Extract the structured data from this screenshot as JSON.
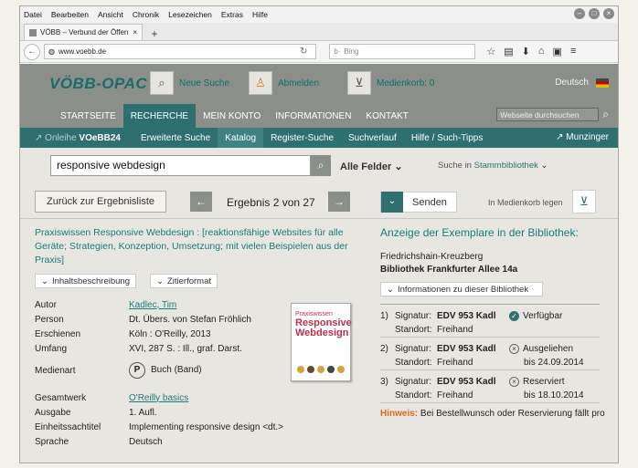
{
  "browser": {
    "menu": [
      "Datei",
      "Bearbeiten",
      "Ansicht",
      "Chronik",
      "Lesezeichen",
      "Extras",
      "Hilfe"
    ],
    "tab_title": "VÖBB – Verbund der Öffent…",
    "url": "www.voebb.de",
    "search_placeholder": "Bing"
  },
  "header": {
    "logo": "VÖBB-OPAC",
    "new_search": "Neue Suche",
    "logout": "Abmelden",
    "cart": "Medienkorb: 0",
    "language": "Deutsch"
  },
  "mainnav": {
    "items": [
      "STARTSEITE",
      "RECHERCHE",
      "MEIN KONTO",
      "INFORMATIONEN",
      "KONTAKT"
    ],
    "site_search_placeholder": "Webseite durchsuchen"
  },
  "subnav": {
    "online_prefix": "Onleihe",
    "online_name": "VOeBB24",
    "items": [
      "Erweiterte Suche",
      "Katalog",
      "Register-Suche",
      "Suchverlauf",
      "Hilfe / Such-Tipps"
    ],
    "user": "Munzinger"
  },
  "search": {
    "query": "responsive webdesign",
    "fields": "Alle Felder",
    "search_in_prefix": "Suche in",
    "search_in_value": "Stammbibliothek"
  },
  "actions": {
    "back": "Zurück zur Ergebnisliste",
    "result": "Ergebnis 2 von 27",
    "send": "Senden",
    "add_to_cart": "In Medienkorb legen"
  },
  "record": {
    "title": "Praxiswissen Responsive Webdesign : [reaktionsfähige Websites für alle Geräte; Strategien, Konzeption, Umsetzung; mit vielen Beispielen aus der Praxis]",
    "description_btn": "Inhaltsbeschreibung",
    "cite_btn": "Zitierformat",
    "cover_line1": "Praxiswissen",
    "cover_line2": "Responsive",
    "cover_line3": "Webdesign",
    "fields": [
      {
        "k": "Autor",
        "v": "Kadlec, Tim",
        "link": true
      },
      {
        "k": "Person",
        "v": "Dt. Übers. von Stefan Fröhlich",
        "link": false
      },
      {
        "k": "Erschienen",
        "v": "Köln : O'Reilly, 2013",
        "link": false
      },
      {
        "k": "Umfang",
        "v": "XVI, 287 S. : Ill., graf. Darst.",
        "link": false
      }
    ],
    "media_label": "Medienart",
    "media_value": "Buch (Band)",
    "fields2": [
      {
        "k": "Gesamtwerk",
        "v": "O'Reilly basics",
        "link": true
      },
      {
        "k": "Ausgabe",
        "v": "1. Aufl.",
        "link": false
      },
      {
        "k": "Einheitssachtitel",
        "v": "Implementing responsive design <dt.>",
        "link": false
      },
      {
        "k": "Sprache",
        "v": "Deutsch",
        "link": false
      }
    ]
  },
  "holdings": {
    "heading": "Anzeige der Exemplare in der Bibliothek:",
    "district": "Friedrichshain-Kreuzberg",
    "branch": "Bibliothek Frankfurter Allee 14a",
    "info_btn": "Informationen zu dieser Bibliothek",
    "sig_label": "Signatur:",
    "loc_label": "Standort:",
    "copies": [
      {
        "n": "1)",
        "sig": "EDV 953 Kadl",
        "loc": "Freihand",
        "status": "Verfügbar",
        "status2": "",
        "available": true
      },
      {
        "n": "2)",
        "sig": "EDV 953 Kadl",
        "loc": "Freihand",
        "status": "Ausgeliehen",
        "status2": "bis 24.09.2014",
        "available": false
      },
      {
        "n": "3)",
        "sig": "EDV 953 Kadl",
        "loc": "Freihand",
        "status": "Reserviert",
        "status2": "bis 18.10.2014",
        "available": false
      }
    ],
    "hint_label": "Hinweis:",
    "hint_text": "Bei Bestellwunsch oder Reservierung fällt pro"
  }
}
